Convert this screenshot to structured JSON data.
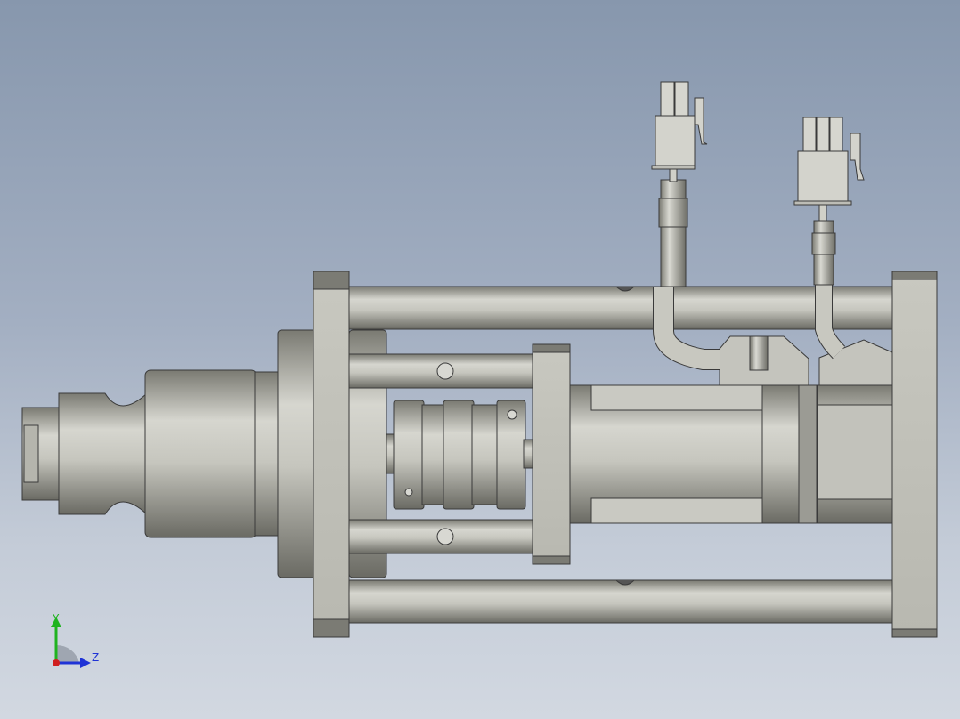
{
  "viewport": {
    "background_top": "#8797ad",
    "background_bottom": "#d2d8e1"
  },
  "model": {
    "edge_color": "#3a3a3a",
    "body_light": "#d8d8d2",
    "body_mid": "#b9b9b1",
    "body_dark": "#76766e"
  },
  "triad": {
    "y_label": "Y",
    "z_label": "Z",
    "y_color": "#1fb31f",
    "z_color": "#1f33d6",
    "origin_color": "#d01f1f"
  }
}
